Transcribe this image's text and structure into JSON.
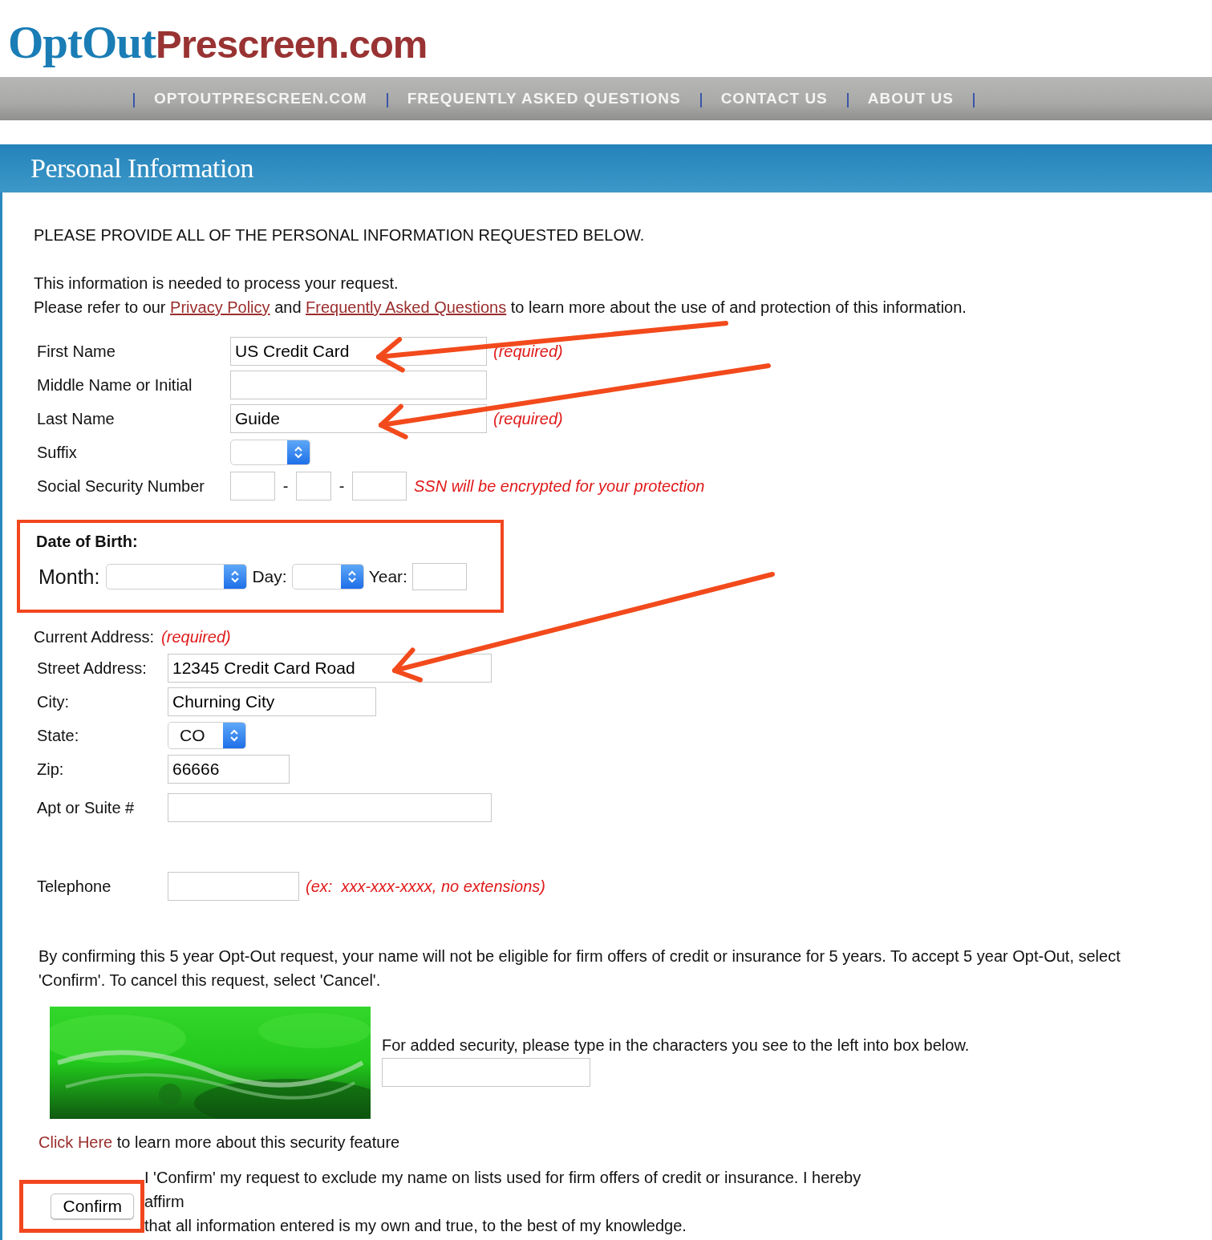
{
  "logo": {
    "part_1": "OptOut",
    "part_2": "Prescreen.com"
  },
  "nav": [
    {
      "label": "OPTOUTPRESCREEN.COM"
    },
    {
      "label": "FREQUENTLY ASKED QUESTIONS"
    },
    {
      "label": "CONTACT US"
    },
    {
      "label": "ABOUT US"
    }
  ],
  "section_title": "Personal Information",
  "instructions": "PLEASE PROVIDE ALL OF THE PERSONAL INFORMATION REQUESTED BELOW.",
  "intro_line": "This information is needed to process your request.",
  "intro_sentence": [
    {
      "kind": "text",
      "text": "Please refer to our "
    },
    {
      "kind": "link",
      "text": "Privacy Policy"
    },
    {
      "kind": "text",
      "text": " and "
    },
    {
      "kind": "link",
      "text": "Frequently Asked Questions"
    },
    {
      "kind": "text",
      "text": " to learn more about the use of and protection of this information."
    }
  ],
  "name_fields": [
    {
      "kind": "text",
      "label": "First Name",
      "value": "US Credit Card",
      "note": "(required)"
    },
    {
      "kind": "text",
      "label": "Middle Name or Initial"
    },
    {
      "kind": "text",
      "label": "Last Name",
      "value": "Guide",
      "note": "(required)"
    },
    {
      "kind": "select",
      "label": "Suffix"
    }
  ],
  "ssn": {
    "label": "Social Security Number",
    "separators": [
      "-",
      "-"
    ],
    "note": "SSN will be encrypted for your protection"
  },
  "date_of_birth": {
    "title": "Date of Birth:",
    "month_label": "Month:",
    "day_label": "Day:",
    "year_label": "Year:"
  },
  "address": {
    "heading": "Current Address:",
    "note": "(required)",
    "fields": [
      {
        "kind": "text",
        "label": "Street Address:",
        "value": "12345 Credit Card Road"
      },
      {
        "kind": "text",
        "label": "City:",
        "value": "Churning City"
      },
      {
        "kind": "select",
        "label": "State:",
        "value": "CO"
      },
      {
        "kind": "text",
        "label": "Zip:",
        "value": "66666"
      },
      {
        "kind": "text",
        "label": "Apt or Suite #"
      }
    ]
  },
  "telephone": {
    "label": "Telephone",
    "note": "(ex:  xxx-xxx-xxxx, no extensions)"
  },
  "disclaimer": "By confirming this 5 year Opt-Out request, your name will not be eligible for firm offers of credit or insurance for 5 years. To accept 5 year Opt-Out, select 'Confirm'. To cancel this request, select 'Cancel'.",
  "captcha": {
    "kind": "picture",
    "instruction": "For added security, please type in the characters you see to the left into box below."
  },
  "security_link": {
    "link": "Click Here",
    "text": " to learn more about this security feature"
  },
  "confirm_button": "Confirm",
  "affirmation": [
    "I 'Confirm' my request to exclude my name on lists used for firm offers of credit or insurance. I hereby",
    "affirm",
    "that all information entered is my own and true, to the best of my knowledge."
  ]
}
